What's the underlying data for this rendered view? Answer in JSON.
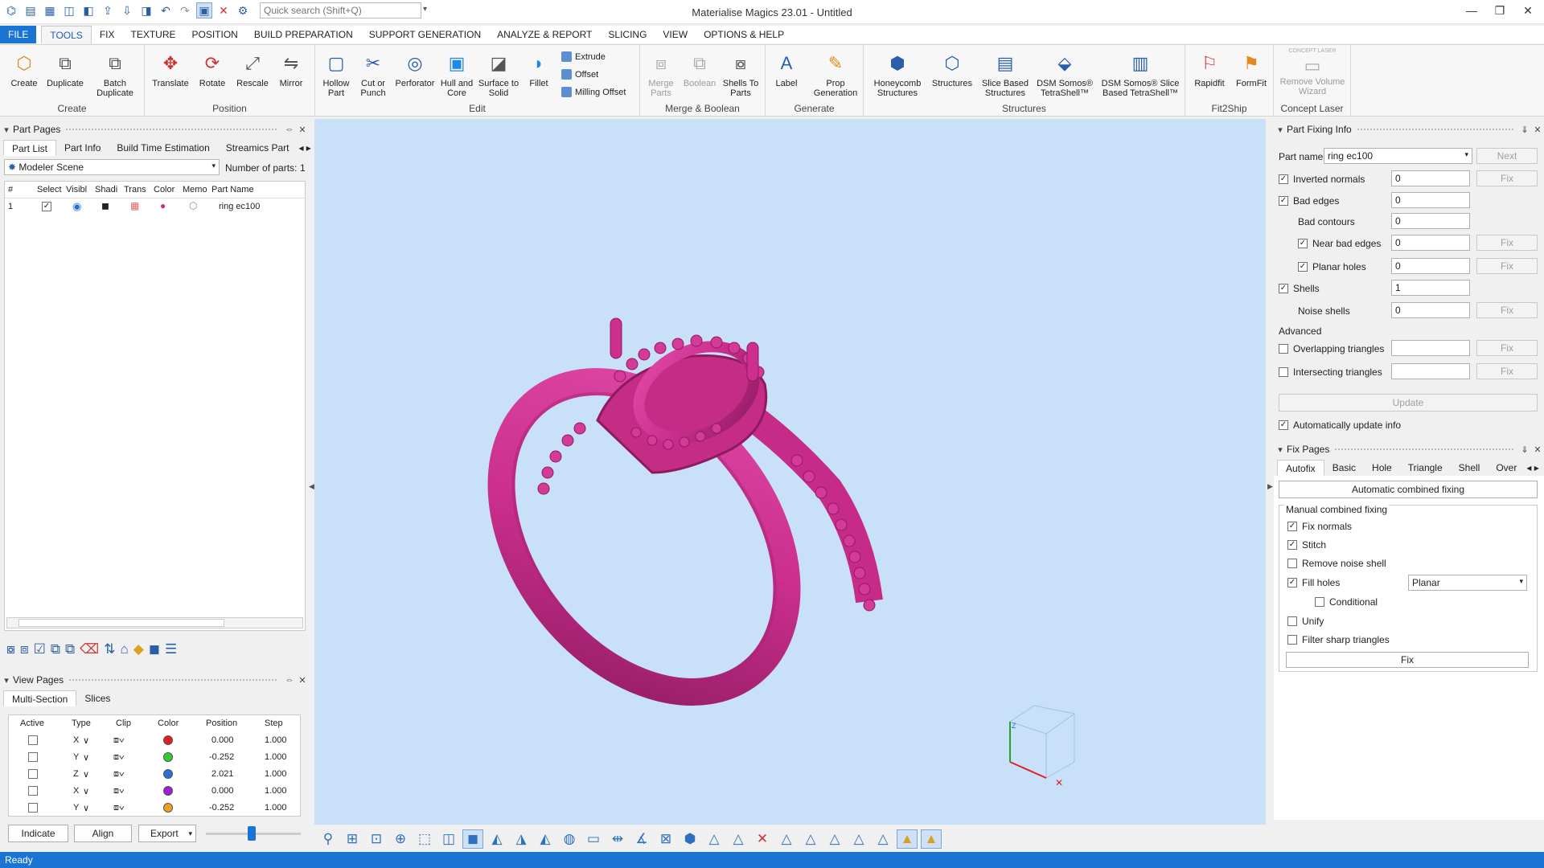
{
  "window": {
    "title": "Materialise Magics 23.01 - Untitled",
    "search_placeholder": "Quick search (Shift+Q)"
  },
  "menu": [
    "FILE",
    "TOOLS",
    "FIX",
    "TEXTURE",
    "POSITION",
    "BUILD PREPARATION",
    "SUPPORT GENERATION",
    "ANALYZE & REPORT",
    "SLICING",
    "VIEW",
    "OPTIONS & HELP"
  ],
  "ribbon": {
    "create": {
      "label": "Create",
      "buttons": [
        "Create",
        "Duplicate",
        "Batch Duplicate"
      ]
    },
    "position": {
      "label": "Position",
      "buttons": [
        "Translate",
        "Rotate",
        "Rescale",
        "Mirror"
      ]
    },
    "edit": {
      "label": "Edit",
      "buttons": [
        "Hollow Part",
        "Cut or Punch",
        "Perforator",
        "Hull and Core",
        "Surface to Solid",
        "Fillet"
      ],
      "small": [
        "Extrude",
        "Offset",
        "Milling Offset"
      ]
    },
    "merge": {
      "label": "Merge & Boolean",
      "buttons": [
        "Merge Parts",
        "Boolean",
        "Shells To Parts"
      ]
    },
    "generate": {
      "label": "Generate",
      "buttons": [
        "Label",
        "Prop Generation"
      ]
    },
    "structures": {
      "label": "Structures",
      "buttons": [
        "Honeycomb Structures",
        "Structures",
        "Slice Based Structures",
        "DSM Somos® TetraShell™",
        "DSM Somos® Slice Based TetraShell™"
      ]
    },
    "fit2ship": {
      "label": "Fit2Ship",
      "buttons": [
        "Rapidfit",
        "FormFit"
      ]
    },
    "concept": {
      "label": "Concept Laser",
      "buttons": [
        "Remove Volume Wizard"
      ],
      "badge": "CONCEPT LASER"
    }
  },
  "part_pages": {
    "title": "Part Pages",
    "tabs": [
      "Part List",
      "Part Info",
      "Build Time Estimation",
      "Streamics Part"
    ],
    "scene": "Modeler Scene",
    "count_label": "Number of parts:",
    "count": "1",
    "columns": [
      "#",
      "Select",
      "Visibl",
      "Shadi",
      "Trans",
      "Color",
      "Memo",
      "Part Name"
    ],
    "rows": [
      {
        "num": "1",
        "name": "ring ec100"
      }
    ]
  },
  "view_pages": {
    "title": "View Pages",
    "tabs": [
      "Multi-Section",
      "Slices"
    ],
    "columns": [
      "Active",
      "Type",
      "Clip",
      "Color",
      "Position",
      "Step"
    ],
    "rows": [
      {
        "type": "X",
        "color": "#e02020",
        "position": "0.000",
        "step": "1.000"
      },
      {
        "type": "Y",
        "color": "#2ecc2e",
        "position": "-0.252",
        "step": "1.000"
      },
      {
        "type": "Z",
        "color": "#2a6fd6",
        "position": "2.021",
        "step": "1.000"
      },
      {
        "type": "X",
        "color": "#9b1fd6",
        "position": "0.000",
        "step": "1.000"
      },
      {
        "type": "Y",
        "color": "#f0a020",
        "position": "-0.252",
        "step": "1.000"
      }
    ],
    "buttons": [
      "Indicate",
      "Align",
      "Export"
    ]
  },
  "part_fixing": {
    "title": "Part Fixing Info",
    "part_name_label": "Part name",
    "part_name": "ring ec100",
    "next": "Next",
    "rows": [
      {
        "label": "Inverted normals",
        "value": "0",
        "fix": "Fix"
      },
      {
        "label": "Bad edges",
        "value": "0"
      },
      {
        "label": "Bad contours",
        "value": "0"
      },
      {
        "label": "Near bad edges",
        "value": "0",
        "fix": "Fix"
      },
      {
        "label": "Planar holes",
        "value": "0",
        "fix": "Fix"
      },
      {
        "label": "Shells",
        "value": "1"
      },
      {
        "label": "Noise shells",
        "value": "0",
        "fix": "Fix"
      }
    ],
    "advanced": "Advanced",
    "overlapping": "Overlapping triangles",
    "intersecting": "Intersecting triangles",
    "fix": "Fix",
    "update": "Update",
    "auto_update": "Automatically update info"
  },
  "fix_pages": {
    "title": "Fix Pages",
    "tabs": [
      "Autofix",
      "Basic",
      "Hole",
      "Triangle",
      "Shell",
      "Over"
    ],
    "auto_button": "Automatic combined fixing",
    "manual_label": "Manual combined fixing",
    "options": [
      "Fix normals",
      "Stitch",
      "Remove noise shell",
      "Fill holes",
      "Conditional",
      "Unify",
      "Filter sharp triangles"
    ],
    "fill_mode": "Planar",
    "fix_button": "Fix"
  },
  "status": "Ready",
  "colors": {
    "accent": "#1a74d3",
    "model": "#cc2f8e",
    "viewport": "#c9e1f8"
  }
}
